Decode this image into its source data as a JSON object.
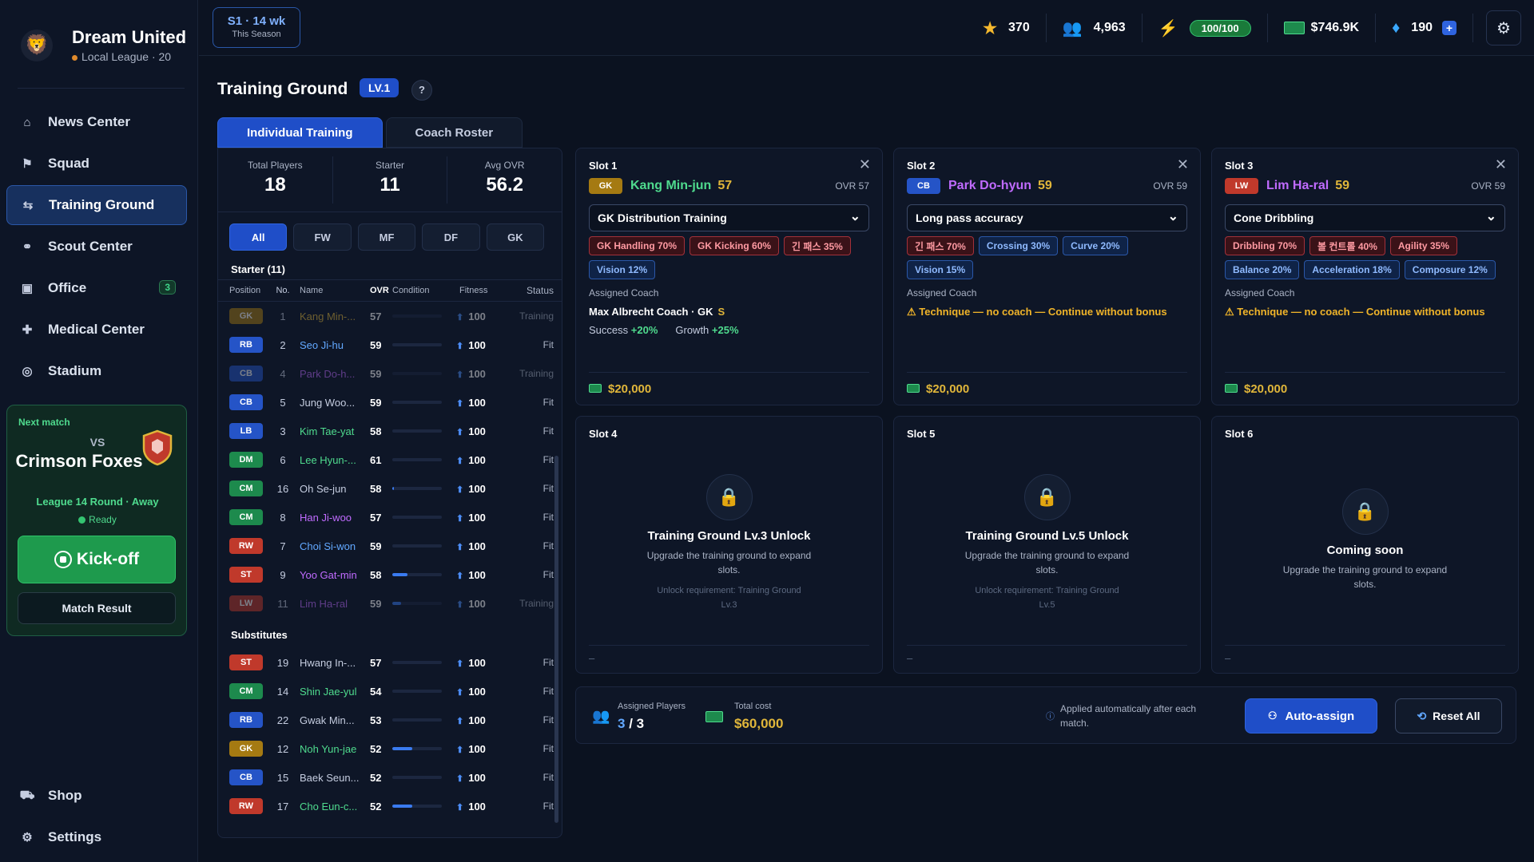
{
  "brand": {
    "name": "Dream United",
    "league": "Local League · 20",
    "logo": "🦁"
  },
  "nav": [
    {
      "label": "News Center",
      "icon": "home-icon",
      "glyph": "⌂"
    },
    {
      "label": "Squad",
      "icon": "squad-icon",
      "glyph": "⚑"
    },
    {
      "label": "Training Ground",
      "icon": "training-icon",
      "glyph": "⇆",
      "active": true
    },
    {
      "label": "Scout Center",
      "icon": "binoculars-icon",
      "glyph": "⚭"
    },
    {
      "label": "Office",
      "icon": "office-icon",
      "glyph": "▣",
      "badge": "3"
    },
    {
      "label": "Medical Center",
      "icon": "medical-icon",
      "glyph": "✚"
    },
    {
      "label": "Stadium",
      "icon": "stadium-icon",
      "glyph": "◎"
    }
  ],
  "bottom_nav": [
    {
      "label": "Shop",
      "icon": "cart-icon",
      "glyph": "⛟"
    },
    {
      "label": "Settings",
      "icon": "gear-icon",
      "glyph": "⚙"
    }
  ],
  "match": {
    "label": "Next match",
    "vs": "VS",
    "team": "Crimson Foxes",
    "info": "League 14 Round · Away",
    "status": "Ready",
    "kickoff": "Kick-off",
    "result": "Match Result"
  },
  "season": {
    "main": "S1 · 14 wk",
    "sub": "This Season"
  },
  "stats": {
    "stars": "370",
    "fans": "4,963",
    "energy": "100/100",
    "money": "$746.9K",
    "gems": "190",
    "plus": "+"
  },
  "page": {
    "title": "Training Ground",
    "level": "LV.1",
    "help": "?"
  },
  "tabs": [
    "Individual Training",
    "Coach Roster"
  ],
  "summary": {
    "total_label": "Total Players",
    "total": "18",
    "starter_label": "Starter",
    "starter": "11",
    "avg_label": "Avg OVR",
    "avg": "56.2"
  },
  "filters": [
    "All",
    "FW",
    "MF",
    "DF",
    "GK"
  ],
  "starter_title": "Starter (11)",
  "subs_title": "Substitutes",
  "columns": [
    "Position",
    "No.",
    "Name",
    "OVR",
    "Condition",
    "Fitness",
    "Status"
  ],
  "starters": [
    {
      "pos": "GK",
      "no": "1",
      "name": "Kang Min-...",
      "ovr": "57",
      "cond": 0,
      "fit": "100",
      "status": "Training",
      "dim": true,
      "color": "GK"
    },
    {
      "pos": "RB",
      "no": "2",
      "name": "Seo Ji-hu",
      "ovr": "59",
      "cond": 0,
      "fit": "100",
      "status": "Fit",
      "color": "DEF"
    },
    {
      "pos": "CB",
      "no": "4",
      "name": "Park Do-h...",
      "ovr": "59",
      "cond": 0,
      "fit": "100",
      "status": "Training",
      "dim": true,
      "color": "ATT"
    },
    {
      "pos": "CB",
      "no": "5",
      "name": "Jung Woo...",
      "ovr": "59",
      "cond": 0,
      "fit": "100",
      "status": "Fit",
      "color": "plain"
    },
    {
      "pos": "LB",
      "no": "3",
      "name": "Kim Tae-yat",
      "ovr": "58",
      "cond": 0,
      "fit": "100",
      "status": "Fit",
      "color": "MID"
    },
    {
      "pos": "DM",
      "no": "6",
      "name": "Lee Hyun-...",
      "ovr": "61",
      "cond": 0,
      "fit": "100",
      "status": "Fit",
      "color": "MID"
    },
    {
      "pos": "CM",
      "no": "16",
      "name": "Oh Se-jun",
      "ovr": "58",
      "cond": 0.03,
      "fit": "100",
      "status": "Fit",
      "color": "plain"
    },
    {
      "pos": "CM",
      "no": "8",
      "name": "Han Ji-woo",
      "ovr": "57",
      "cond": 0,
      "fit": "100",
      "status": "Fit",
      "color": "ATT"
    },
    {
      "pos": "RW",
      "no": "7",
      "name": "Choi Si-won",
      "ovr": "59",
      "cond": 0,
      "fit": "100",
      "status": "Fit",
      "color": "DEF"
    },
    {
      "pos": "ST",
      "no": "9",
      "name": "Yoo Gat-min",
      "ovr": "58",
      "cond": 0.3,
      "fit": "100",
      "status": "Fit",
      "color": "ATT"
    },
    {
      "pos": "LW",
      "no": "11",
      "name": "Lim Ha-ral",
      "ovr": "59",
      "cond": 0.18,
      "fit": "100",
      "status": "Training",
      "dim": true,
      "color": "ATT"
    }
  ],
  "substitutes": [
    {
      "pos": "ST",
      "no": "19",
      "name": "Hwang In-...",
      "ovr": "57",
      "cond": 0,
      "fit": "100",
      "status": "Fit",
      "color": "plain"
    },
    {
      "pos": "CM",
      "no": "14",
      "name": "Shin Jae-yul",
      "ovr": "54",
      "cond": 0,
      "fit": "100",
      "status": "Fit",
      "color": "MID"
    },
    {
      "pos": "RB",
      "no": "22",
      "name": "Gwak Min...",
      "ovr": "53",
      "cond": 0,
      "fit": "100",
      "status": "Fit",
      "color": "plain"
    },
    {
      "pos": "GK",
      "no": "12",
      "name": "Noh Yun-jae",
      "ovr": "52",
      "cond": 0.4,
      "fit": "100",
      "status": "Fit",
      "color": "MID"
    },
    {
      "pos": "CB",
      "no": "15",
      "name": "Baek Seun...",
      "ovr": "52",
      "cond": 0,
      "fit": "100",
      "status": "Fit",
      "color": "plain"
    },
    {
      "pos": "RW",
      "no": "17",
      "name": "Cho Eun-c...",
      "ovr": "52",
      "cond": 0.4,
      "fit": "100",
      "status": "Fit",
      "color": "MID"
    }
  ],
  "slots": [
    {
      "title": "Slot 1",
      "pos": "GK",
      "player": "Kang Min-jun",
      "player_color": "#4fdb8e",
      "ovr": "57",
      "ovr_label": "OVR 57",
      "training": "GK Distribution Training",
      "chips": [
        {
          "t": "GK Handling 70%",
          "c": "red"
        },
        {
          "t": "GK Kicking 60%",
          "c": "red"
        },
        {
          "t": "긴 패스 35%",
          "c": "red"
        },
        {
          "t": "Vision 12%",
          "c": "blue"
        }
      ],
      "coach_label": "Assigned Coach",
      "coach": "Max Albrecht Coach · GK",
      "coach_mark": "S",
      "success_label": "Success",
      "success": "+20%",
      "growth_label": "Growth",
      "growth": "+25%",
      "cost": "$20,000"
    },
    {
      "title": "Slot 2",
      "pos": "CB",
      "player": "Park Do-hyun",
      "player_color": "#c06bff",
      "ovr": "59",
      "ovr_label": "OVR 59",
      "training": "Long pass accuracy",
      "chips": [
        {
          "t": "긴 패스 70%",
          "c": "red"
        },
        {
          "t": "Crossing 30%",
          "c": "blue"
        },
        {
          "t": "Curve 20%",
          "c": "blue"
        },
        {
          "t": "Vision 15%",
          "c": "blue"
        }
      ],
      "coach_label": "Assigned Coach",
      "warning": "⚠ Technique — no coach — Continue without bonus",
      "cost": "$20,000"
    },
    {
      "title": "Slot 3",
      "pos": "LW",
      "player": "Lim Ha-ral",
      "player_color": "#c06bff",
      "ovr": "59",
      "ovr_label": "OVR 59",
      "training": "Cone Dribbling",
      "chips": [
        {
          "t": "Dribbling 70%",
          "c": "red"
        },
        {
          "t": "볼 컨트롤 40%",
          "c": "red"
        },
        {
          "t": "Agility 35%",
          "c": "red"
        },
        {
          "t": "Balance 20%",
          "c": "blue"
        },
        {
          "t": "Acceleration 18%",
          "c": "blue"
        },
        {
          "t": "Composure 12%",
          "c": "blue"
        }
      ],
      "coach_label": "Assigned Coach",
      "warning": "⚠ Technique — no coach — Continue without bonus",
      "cost": "$20,000"
    }
  ],
  "locked_slots": [
    {
      "title": "Slot 4",
      "heading": "Training Ground Lv.3 Unlock",
      "desc": "Upgrade the training ground to expand slots.",
      "req": "Unlock requirement: Training Ground Lv.3",
      "dash": "–"
    },
    {
      "title": "Slot 5",
      "heading": "Training Ground Lv.5 Unlock",
      "desc": "Upgrade the training ground to expand slots.",
      "req": "Unlock requirement: Training Ground Lv.5",
      "dash": "–"
    },
    {
      "title": "Slot 6",
      "heading": "Coming soon",
      "desc": "Upgrade the training ground to expand slots.",
      "req": "",
      "dash": "–"
    }
  ],
  "footer": {
    "assigned_label": "Assigned Players",
    "assigned": "3",
    "assigned_total": " / 3",
    "cost_label": "Total cost",
    "cost": "$60,000",
    "note": "Applied automatically after each match.",
    "auto": "Auto-assign",
    "reset": "Reset All"
  }
}
